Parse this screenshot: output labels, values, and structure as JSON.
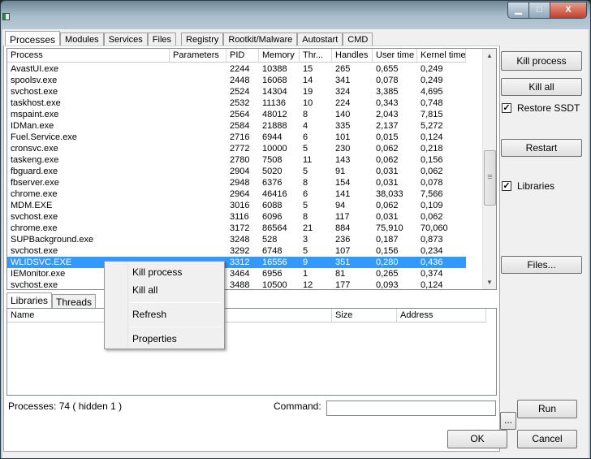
{
  "window": {
    "controls": {
      "minimize": "▁",
      "maximize": "□",
      "close": "X"
    }
  },
  "tabs": [
    "Processes",
    "Modules",
    "Services",
    "Files",
    "Registry",
    "Rootkit/Malware",
    "Autostart",
    "CMD"
  ],
  "process_table": {
    "columns": [
      "Process",
      "Parameters",
      "PID",
      "Memory",
      "Thr...",
      "Handles",
      "User time",
      "Kernel time"
    ],
    "rows": [
      [
        "AvastUI.exe",
        "",
        "2244",
        "10388",
        "15",
        "265",
        "0,655",
        "0,249"
      ],
      [
        "spoolsv.exe",
        "",
        "2448",
        "16068",
        "14",
        "341",
        "0,078",
        "0,249"
      ],
      [
        "svchost.exe",
        "",
        "2524",
        "14304",
        "19",
        "324",
        "3,385",
        "4,695"
      ],
      [
        "taskhost.exe",
        "",
        "2532",
        "11136",
        "10",
        "224",
        "0,343",
        "0,748"
      ],
      [
        "mspaint.exe",
        "",
        "2564",
        "48012",
        "8",
        "140",
        "2,043",
        "7,815"
      ],
      [
        "IDMan.exe",
        "",
        "2584",
        "21888",
        "4",
        "335",
        "2,137",
        "5,272"
      ],
      [
        "Fuel.Service.exe",
        "",
        "2716",
        "6944",
        "6",
        "101",
        "0,015",
        "0,124"
      ],
      [
        "cronsvc.exe",
        "",
        "2772",
        "10000",
        "5",
        "230",
        "0,062",
        "0,218"
      ],
      [
        "taskeng.exe",
        "",
        "2780",
        "7508",
        "11",
        "143",
        "0,062",
        "0,156"
      ],
      [
        "fbguard.exe",
        "",
        "2904",
        "5020",
        "5",
        "91",
        "0,031",
        "0,062"
      ],
      [
        "fbserver.exe",
        "",
        "2948",
        "6376",
        "8",
        "154",
        "0,031",
        "0,078"
      ],
      [
        "chrome.exe",
        "",
        "2964",
        "46416",
        "6",
        "141",
        "38,033",
        "7,566"
      ],
      [
        "MDM.EXE",
        "",
        "3016",
        "6088",
        "5",
        "94",
        "0,062",
        "0,109"
      ],
      [
        "svchost.exe",
        "",
        "3116",
        "6096",
        "8",
        "117",
        "0,031",
        "0,062"
      ],
      [
        "chrome.exe",
        "",
        "3172",
        "86564",
        "21",
        "884",
        "75,910",
        "70,060"
      ],
      [
        "SUPBackground.exe",
        "",
        "3248",
        "528",
        "3",
        "236",
        "0,187",
        "0,873"
      ],
      [
        "svchost.exe",
        "",
        "3292",
        "6748",
        "5",
        "107",
        "0,156",
        "0,234"
      ],
      [
        "WLIDSVC.EXE",
        "",
        "3312",
        "16556",
        "9",
        "351",
        "0,280",
        "0,436"
      ],
      [
        "IEMonitor.exe",
        "",
        "3464",
        "6956",
        "1",
        "81",
        "0,265",
        "0,374"
      ],
      [
        "svchost.exe",
        "",
        "3488",
        "10500",
        "12",
        "177",
        "0,093",
        "0,124"
      ]
    ],
    "selected_index": 17
  },
  "lower_tabs": [
    "Libraries",
    "Threads"
  ],
  "lower_table": {
    "columns": [
      "Name",
      "Size",
      "Address"
    ]
  },
  "status": {
    "processes": "Processes: 74  ( hidden 1 )",
    "command_label": "Command:",
    "command_value": "",
    "browse": "...",
    "run": "Run"
  },
  "side": {
    "kill_process": "Kill process",
    "kill_all": "Kill all",
    "restore_ssdt": "Restore SSDT",
    "restore_ssdt_checked": true,
    "restart": "Restart",
    "libraries": "Libraries",
    "libraries_checked": true,
    "files": "Files..."
  },
  "footer": {
    "ok": "OK",
    "cancel": "Cancel"
  },
  "context_menu": {
    "items": [
      "Kill process",
      "Kill all",
      "Refresh",
      "Properties"
    ]
  },
  "colors": {
    "selection": "#3399ff"
  }
}
